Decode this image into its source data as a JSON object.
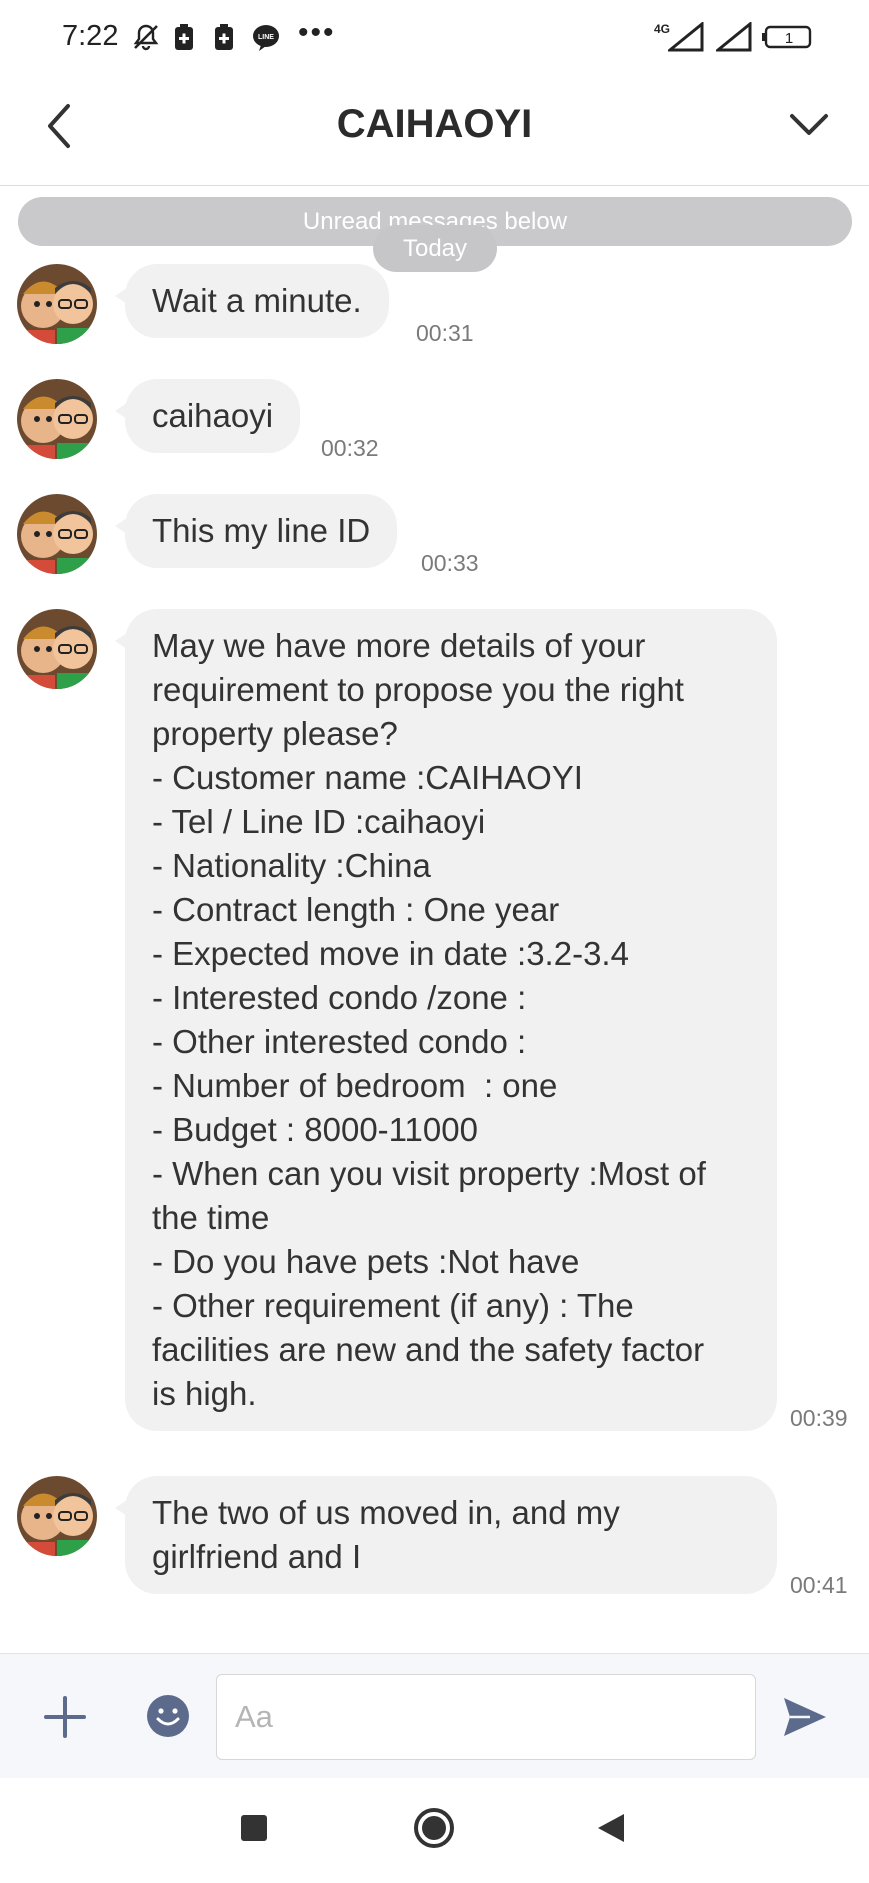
{
  "status_bar": {
    "time": "7:22",
    "network": "4G",
    "battery": "1",
    "icons": [
      "mute-icon",
      "sim-icon",
      "sim-icon",
      "line-app-icon",
      "more-dots-icon",
      "signal-icon",
      "signal-icon",
      "battery-icon"
    ],
    "more": "•••"
  },
  "header": {
    "title": "CAIHAOYI",
    "back_icon": "chevron-left-icon",
    "menu_icon": "chevron-down-icon"
  },
  "chat": {
    "unread_label": "Unread messages below",
    "date_label": "Today",
    "messages": [
      {
        "lines": [
          "Wait a minute."
        ],
        "time": "00:31"
      },
      {
        "lines": [
          "caihaoyi"
        ],
        "time": "00:32"
      },
      {
        "lines": [
          "This my line ID"
        ],
        "time": "00:33"
      },
      {
        "lines": [
          "May we have more details of your",
          "requirement to propose you the right",
          "property please?",
          "- Customer name :CAIHAOYI",
          "- Tel / Line ID :caihaoyi",
          "- Nationality :China",
          "- Contract length : One year",
          "- Expected move in date :3.2-3.4",
          "- Interested condo /zone :",
          "- Other interested condo :",
          "- Number of bedroom  : one",
          "- Budget : 8000-11000",
          "- When can you visit property :Most of",
          "the time",
          "- Do you have pets :Not have",
          "- Other requirement (if any) : The",
          "facilities are new and the safety factor",
          "is high."
        ],
        "time": "00:39"
      },
      {
        "lines": [
          "The two of us moved in, and my",
          "girlfriend and I"
        ],
        "time": "00:41"
      }
    ]
  },
  "input_bar": {
    "placeholder": "Aa",
    "value": "",
    "plus_icon": "plus-icon",
    "emoji_icon": "emoji-icon",
    "send_icon": "send-icon"
  },
  "nav_bar": {
    "icons": [
      "recents-square-icon",
      "home-circle-icon",
      "back-triangle-icon"
    ]
  },
  "colors": {
    "bubble": "#f1f1f2",
    "unread_bar": "#c9c9cb",
    "accent_icon": "#5c6a8c"
  }
}
